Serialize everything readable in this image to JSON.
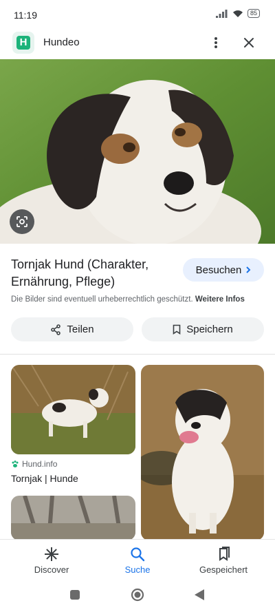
{
  "status": {
    "time": "11:19",
    "battery": "85"
  },
  "app": {
    "name": "Hundeo"
  },
  "result": {
    "title": "Tornjak Hund (Charakter, Ernährung, Pflege)",
    "visit_label": "Besuchen",
    "copyright_text": "Die Bilder sind eventuell urheberrechtlich geschützt.",
    "more_info_label": "Weitere Infos",
    "share_label": "Teilen",
    "save_label": "Speichern"
  },
  "related": [
    {
      "source": "Hund.info",
      "title": "Tornjak | Hunde"
    }
  ],
  "bottom_nav": [
    {
      "label": "Discover",
      "icon": "asterisk-icon"
    },
    {
      "label": "Suche",
      "icon": "search-icon",
      "active": true
    },
    {
      "label": "Gespeichert",
      "icon": "bookmarks-icon"
    }
  ],
  "colors": {
    "accent": "#1a73e8",
    "visit_bg": "#e8f0fe",
    "chip_bg": "#f1f3f4",
    "brand": "#1cb37a"
  }
}
